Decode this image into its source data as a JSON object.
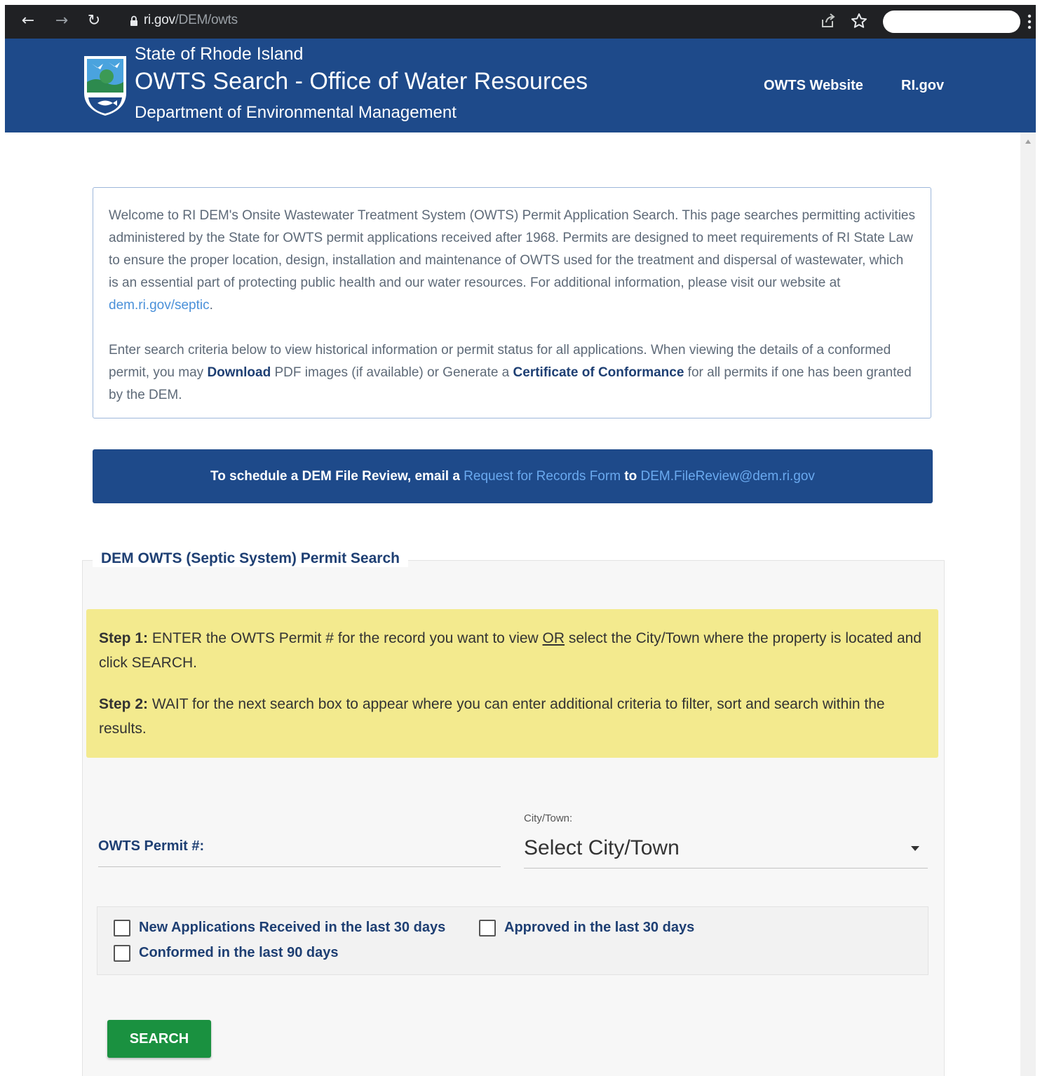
{
  "browser": {
    "url_domain": "ri.gov",
    "url_path": "/DEM/owts"
  },
  "header": {
    "state_name": "State of Rhode Island",
    "title": "OWTS Search - Office of Water Resources",
    "department": "Department of Environmental Management",
    "nav": [
      "OWTS Website",
      "RI.gov"
    ]
  },
  "intro": {
    "p1_text": "Welcome to RI DEM's Onsite Wastewater Treatment System (OWTS) Permit Application Search. This page searches permitting activities administered by the State for OWTS permit applications received after 1968. Permits are designed to meet requirements of RI State Law to ensure the proper location, design, installation and maintenance of OWTS used for the treatment and dispersal of wastewater, which is an essential part of protecting public health and our water resources. For additional information, please visit our website at ",
    "p1_link": "dem.ri.gov/septic",
    "p1_end": ".",
    "p2_a": "Enter search criteria below to view historical information or permit status for all applications. When viewing the details of a conformed permit, you may ",
    "p2_download": "Download",
    "p2_b": " PDF images (if available) or Generate a ",
    "p2_certificate": "Certificate of Conformance",
    "p2_c": " for all permits if one has been granted by the DEM."
  },
  "review_banner": {
    "text_a": "To schedule a DEM File Review, email a ",
    "link_form": "Request for Records Form",
    "text_b": " to ",
    "link_email": "DEM.FileReview@dem.ri.gov"
  },
  "search": {
    "legend": "DEM OWTS (Septic System) Permit Search",
    "step1_label": "Step 1:",
    "step1_a": " ENTER the OWTS Permit # for the record you want to view ",
    "step1_or": "OR",
    "step1_b": " select the City/Town where the property is located and click SEARCH.",
    "step2_label": "Step 2:",
    "step2_text": " WAIT for the next search box to appear where you can enter additional criteria to filter, sort and search within the results.",
    "permit_label": "OWTS Permit #:",
    "permit_value": "",
    "city_label": "City/Town:",
    "city_value": "Select City/Town",
    "filters": [
      {
        "label": "New Applications Received in the last 30 days",
        "checked": false
      },
      {
        "label": "Approved in the last 30 days",
        "checked": false
      },
      {
        "label": "Conformed in the last 90 days",
        "checked": false
      }
    ],
    "button_label": "SEARCH"
  },
  "colors": {
    "header_blue": "#1e4a8a",
    "steps_yellow": "#f3ea8e",
    "button_green": "#1a9140",
    "link_blue": "#4a90d9"
  }
}
